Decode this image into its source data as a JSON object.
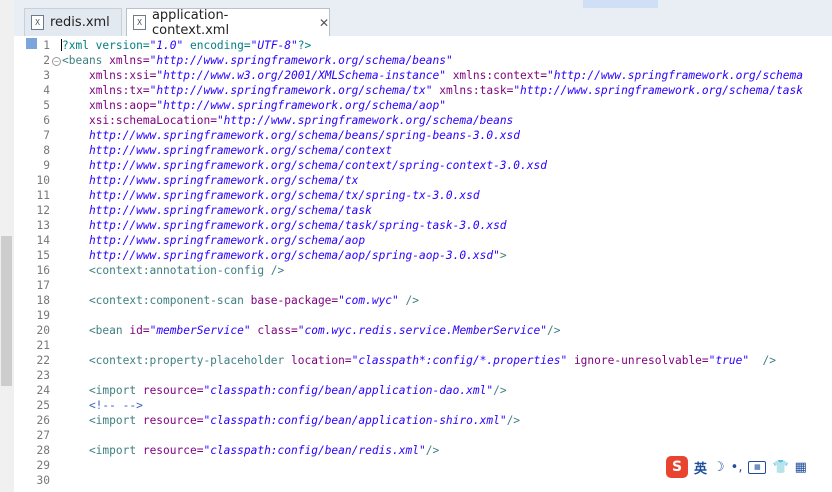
{
  "tabs": [
    {
      "label": "redis.xml",
      "icon": "xml-file-icon",
      "active": false
    },
    {
      "label": "application-context.xml",
      "icon": "xml-file-icon",
      "active": true,
      "close": "✕"
    }
  ],
  "editor": {
    "lines": [
      {
        "n": "1",
        "fold": "",
        "parts": [
          [
            "c",
            "|"
          ],
          [
            "pi",
            "?xml version="
          ],
          [
            "val",
            "\"1.0\""
          ],
          [
            "pi",
            " encoding="
          ],
          [
            "val",
            "\"UTF-8\""
          ],
          [
            "pi",
            "?>"
          ]
        ]
      },
      {
        "n": "2",
        "fold": "⊖",
        "parts": [
          [
            "tag",
            "<beans "
          ],
          [
            "attr",
            "xmlns="
          ],
          [
            "val",
            "\"http://www.springframework.org/schema/beans\""
          ]
        ]
      },
      {
        "n": "3",
        "fold": "",
        "parts": [
          [
            "tag",
            "    "
          ],
          [
            "attr",
            "xmlns:xsi="
          ],
          [
            "val",
            "\"http://www.w3.org/2001/XMLSchema-instance\""
          ],
          [
            "tag",
            " "
          ],
          [
            "attr",
            "xmlns:context="
          ],
          [
            "val",
            "\"http://www.springframework.org/schema"
          ]
        ]
      },
      {
        "n": "4",
        "fold": "",
        "parts": [
          [
            "tag",
            "    "
          ],
          [
            "attr",
            "xmlns:tx="
          ],
          [
            "val",
            "\"http://www.springframework.org/schema/tx\""
          ],
          [
            "tag",
            " "
          ],
          [
            "attr",
            "xmlns:task="
          ],
          [
            "val",
            "\"http://www.springframework.org/schema/task"
          ]
        ]
      },
      {
        "n": "5",
        "fold": "",
        "parts": [
          [
            "tag",
            "    "
          ],
          [
            "attr",
            "xmlns:aop="
          ],
          [
            "val",
            "\"http://www.springframework.org/schema/aop\""
          ]
        ]
      },
      {
        "n": "6",
        "fold": "",
        "parts": [
          [
            "tag",
            "    "
          ],
          [
            "attr",
            "xsi:schemaLocation="
          ],
          [
            "val",
            "\"http://www.springframework.org/schema/beans"
          ]
        ]
      },
      {
        "n": "7",
        "fold": "",
        "parts": [
          [
            "val",
            "    http://www.springframework.org/schema/beans/spring-beans-3.0.xsd"
          ]
        ]
      },
      {
        "n": "8",
        "fold": "",
        "parts": [
          [
            "val",
            "    http://www.springframework.org/schema/context"
          ]
        ]
      },
      {
        "n": "9",
        "fold": "",
        "parts": [
          [
            "val",
            "    http://www.springframework.org/schema/context/spring-context-3.0.xsd"
          ]
        ]
      },
      {
        "n": "10",
        "fold": "",
        "parts": [
          [
            "val",
            "    http://www.springframework.org/schema/tx"
          ]
        ]
      },
      {
        "n": "11",
        "fold": "",
        "parts": [
          [
            "val",
            "    http://www.springframework.org/schema/tx/spring-tx-3.0.xsd"
          ]
        ]
      },
      {
        "n": "12",
        "fold": "",
        "parts": [
          [
            "val",
            "    http://www.springframework.org/schema/task"
          ]
        ]
      },
      {
        "n": "13",
        "fold": "",
        "parts": [
          [
            "val",
            "    http://www.springframework.org/schema/task/spring-task-3.0.xsd"
          ]
        ]
      },
      {
        "n": "14",
        "fold": "",
        "parts": [
          [
            "val",
            "    http://www.springframework.org/schema/aop"
          ]
        ]
      },
      {
        "n": "15",
        "fold": "",
        "parts": [
          [
            "val",
            "    http://www.springframework.org/schema/aop/spring-aop-3.0.xsd\""
          ],
          [
            "tag",
            ">"
          ]
        ]
      },
      {
        "n": "16",
        "fold": "",
        "parts": [
          [
            "tag",
            "    <context:annotation-config />"
          ]
        ]
      },
      {
        "n": "17",
        "fold": "",
        "parts": []
      },
      {
        "n": "18",
        "fold": "",
        "parts": [
          [
            "tag",
            "    <context:component-scan "
          ],
          [
            "attr",
            "base-package="
          ],
          [
            "val",
            "\"com.wyc\""
          ],
          [
            "tag",
            " />"
          ]
        ]
      },
      {
        "n": "19",
        "fold": "",
        "parts": []
      },
      {
        "n": "20",
        "fold": "",
        "parts": [
          [
            "tag",
            "    <bean "
          ],
          [
            "attr",
            "id="
          ],
          [
            "val",
            "\"memberService\""
          ],
          [
            "tag",
            " "
          ],
          [
            "attr",
            "class="
          ],
          [
            "val",
            "\"com.wyc.redis.service.MemberService\""
          ],
          [
            "tag",
            "/>"
          ]
        ]
      },
      {
        "n": "21",
        "fold": "",
        "parts": []
      },
      {
        "n": "22",
        "fold": "",
        "parts": [
          [
            "tag",
            "    <context:property-placeholder "
          ],
          [
            "attr",
            "location="
          ],
          [
            "val",
            "\"classpath*:config/*.properties\""
          ],
          [
            "tag",
            " "
          ],
          [
            "attr",
            "ignore-unresolvable="
          ],
          [
            "val",
            "\"true\""
          ],
          [
            "tag",
            "  />"
          ]
        ]
      },
      {
        "n": "23",
        "fold": "",
        "parts": []
      },
      {
        "n": "24",
        "fold": "",
        "parts": [
          [
            "tag",
            "    <import "
          ],
          [
            "attr",
            "resource="
          ],
          [
            "val",
            "\"classpath:config/bean/application-dao.xml\""
          ],
          [
            "tag",
            "/>"
          ]
        ]
      },
      {
        "n": "25",
        "fold": "",
        "parts": [
          [
            "com",
            "    <!-- -->"
          ]
        ]
      },
      {
        "n": "26",
        "fold": "",
        "parts": [
          [
            "tag",
            "    <import "
          ],
          [
            "attr",
            "resource="
          ],
          [
            "val",
            "\"classpath:config/bean/application-shiro.xml\""
          ],
          [
            "tag",
            "/>"
          ]
        ]
      },
      {
        "n": "27",
        "fold": "",
        "parts": []
      },
      {
        "n": "28",
        "fold": "",
        "parts": [
          [
            "tag",
            "    <import "
          ],
          [
            "attr",
            "resource="
          ],
          [
            "val",
            "\"classpath:config/bean/redis.xml\""
          ],
          [
            "tag",
            "/>"
          ]
        ]
      },
      {
        "n": "29",
        "fold": "",
        "parts": []
      },
      {
        "n": "30",
        "fold": "",
        "parts": []
      }
    ]
  },
  "ime": {
    "logo": "S",
    "mode": "英",
    "icons": [
      "moon-icon",
      "punctuation-icon",
      "keyboard-icon",
      "user-icon",
      "grid-icon"
    ],
    "kb": "⌨"
  },
  "colors": {
    "tag": "#3f7f7f",
    "attr": "#7f007f",
    "value": "#2a00ff",
    "comment": "#3f5fbf"
  }
}
